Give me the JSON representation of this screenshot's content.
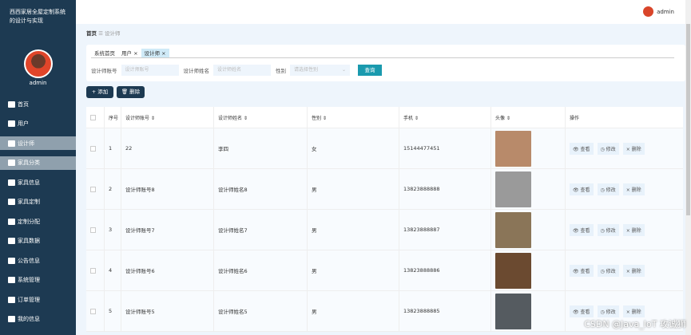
{
  "sidebar": {
    "title": "西西家居全屋定制系统的设计与实现",
    "user": "admin",
    "items": [
      {
        "label": "首页",
        "icon": "home-icon"
      },
      {
        "label": "用户",
        "icon": "grid-icon"
      },
      {
        "label": "设计师",
        "icon": "grid-icon",
        "active": true
      },
      {
        "label": "家具分类",
        "icon": "send-icon",
        "hover": true
      },
      {
        "label": "家具信息",
        "icon": "briefcase-icon"
      },
      {
        "label": "家具定制",
        "icon": "chart-icon"
      },
      {
        "label": "定制分配",
        "icon": "grid-icon"
      },
      {
        "label": "家具数据",
        "icon": "clipboard-icon"
      },
      {
        "label": "公告信息",
        "icon": "bulb-icon"
      },
      {
        "label": "系统管理",
        "icon": "bar-chart-icon"
      },
      {
        "label": "订单管理",
        "icon": "clipboard-check-icon"
      },
      {
        "label": "我的信息",
        "icon": "card-icon"
      }
    ]
  },
  "topbar": {
    "user": "admin"
  },
  "breadcrumb": {
    "home": "首页",
    "sep": "☰",
    "current": "设计师"
  },
  "tabs": [
    {
      "label": "系统首页"
    },
    {
      "label": "用户 ×"
    },
    {
      "label": "设计师 ×",
      "active": true
    }
  ],
  "search": {
    "account_label": "设计师账号",
    "account_placeholder": "设计师账号",
    "name_label": "设计师姓名",
    "name_placeholder": "设计师姓名",
    "gender_label": "性别",
    "gender_placeholder": "请选择性别",
    "query": "查询"
  },
  "actions": {
    "add": "+ 添加",
    "delete": "🗑 删除"
  },
  "table": {
    "headers": [
      "序号",
      "设计师账号 ⇕",
      "设计师姓名 ⇕",
      "性别 ⇕",
      "手机 ⇕",
      "头像 ⇕",
      "操作"
    ],
    "rows": [
      {
        "no": "1",
        "account": "22",
        "name": "李四",
        "gender": "女",
        "phone": "15144477451",
        "color": "#b88a6a"
      },
      {
        "no": "2",
        "account": "设计师账号8",
        "name": "设计师姓名8",
        "gender": "男",
        "phone": "13823888888",
        "color": "#9a9a9a"
      },
      {
        "no": "3",
        "account": "设计师账号7",
        "name": "设计师姓名7",
        "gender": "男",
        "phone": "13823888887",
        "color": "#8a7558"
      },
      {
        "no": "4",
        "account": "设计师账号6",
        "name": "设计师姓名6",
        "gender": "男",
        "phone": "13823888886",
        "color": "#6b4a30"
      },
      {
        "no": "5",
        "account": "设计师账号5",
        "name": "设计师姓名5",
        "gender": "男",
        "phone": "13823888885",
        "color": "#555b60"
      }
    ],
    "view": "👁 查看",
    "edit": "◷ 修改",
    "del": "× 删除"
  },
  "watermark": "CSDN @Java_IoT 攻诚狮"
}
